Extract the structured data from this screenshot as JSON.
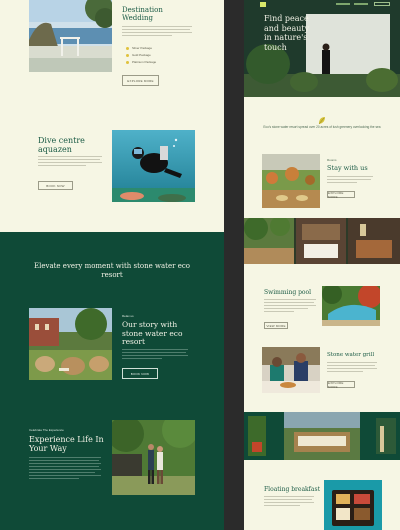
{
  "left": {
    "wedding": {
      "title_line1": "Destination",
      "title_line2": "Wedding",
      "bullets": [
        "Silver Package",
        "Gold Package",
        "Platinum Package"
      ],
      "button": "EXPLORE MORE"
    },
    "dive": {
      "title_line1": "Dive centre",
      "title_line2": "aquazen",
      "button": "BOOK NOW"
    },
    "elevate": {
      "title_line1": "Elevate every moment with stone water eco",
      "title_line2": "resort"
    },
    "story": {
      "eyebrow": "Relax us",
      "title_line1": "Our story with",
      "title_line2": "stone water eco",
      "title_line3": "resort",
      "button": "BOOK NOW"
    },
    "experience": {
      "eyebrow": "Celebrate The Experience",
      "title_line1": "Experience Life In",
      "title_line2": "Your Way"
    }
  },
  "right": {
    "hero": {
      "title_line1": "Find peace",
      "title_line2": "and beauty",
      "title_line3": "in nature's",
      "title_line4": "touch"
    },
    "intro": {
      "text": "Eco's stone water resort spread over 20 acres of lush greenery overlooking the sea"
    },
    "stay": {
      "eyebrow": "Rooms",
      "title": "Stay with us",
      "button": "EXPLORE MORE"
    },
    "pool": {
      "title": "Swimming pool",
      "button": "VIEW MORE"
    },
    "grill": {
      "title": "Stone water grill",
      "button": "EXPLORE MORE"
    },
    "breakfast": {
      "title": "Floating breakfast"
    }
  },
  "colors": {
    "cream": "#f6f6e4",
    "forest_green": "#0f4a37",
    "heading_green": "#1b5b45",
    "accent_yellow": "#e0c23d"
  }
}
